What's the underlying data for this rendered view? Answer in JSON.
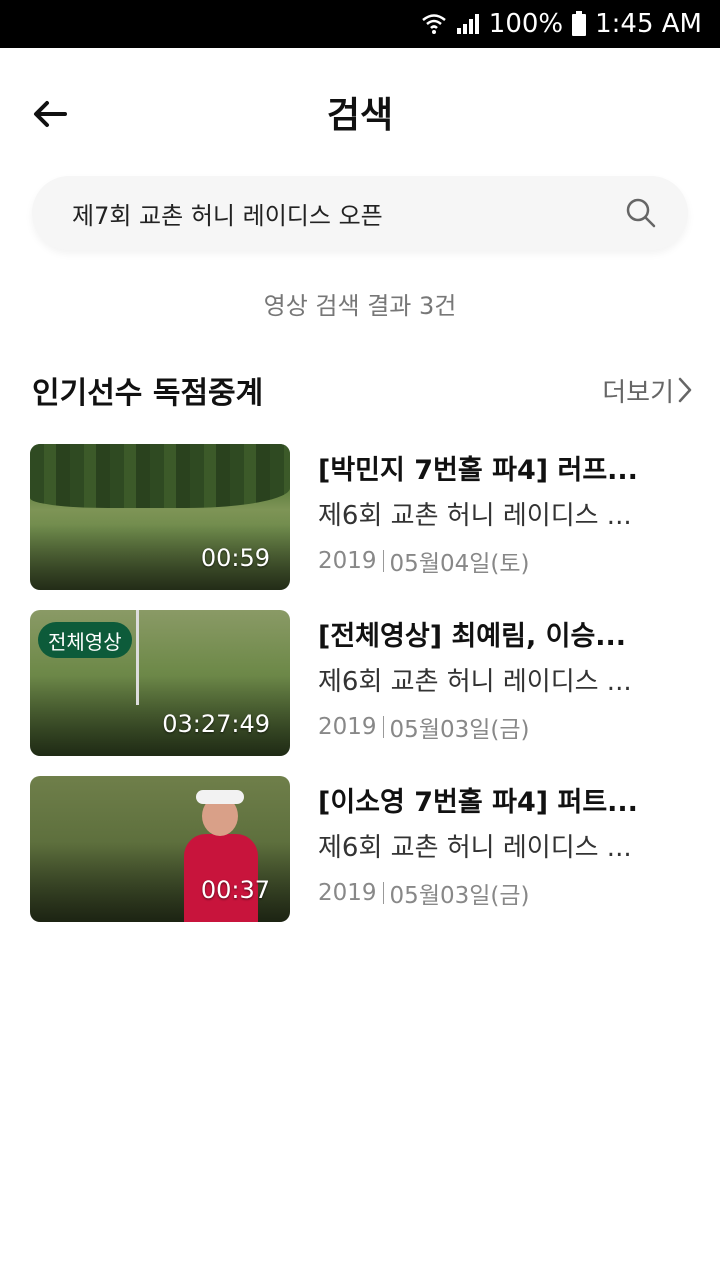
{
  "status": {
    "battery": "100%",
    "time": "1:45 AM"
  },
  "header": {
    "title": "검색"
  },
  "search": {
    "value": "제7회 교촌 허니 레이디스 오픈",
    "placeholder": ""
  },
  "result_count": "영상 검색 결과 3건",
  "section": {
    "title": "인기선수 독점중계",
    "more_label": "더보기"
  },
  "videos": [
    {
      "title": "[박민지 7번홀 파4] 러프...",
      "subtitle": "제6회 교촌 허니 레이디스 ...",
      "year": "2019",
      "date": "05월04일(토)",
      "duration": "00:59",
      "badge": ""
    },
    {
      "title": "[전체영상] 최예림, 이승...",
      "subtitle": "제6회 교촌 허니 레이디스 ...",
      "year": "2019",
      "date": "05월03일(금)",
      "duration": "03:27:49",
      "badge": "전체영상"
    },
    {
      "title": "[이소영 7번홀 파4] 퍼트...",
      "subtitle": "제6회 교촌 허니 레이디스 ...",
      "year": "2019",
      "date": "05월03일(금)",
      "duration": "00:37",
      "badge": ""
    }
  ],
  "colors": {
    "badge_bg": "#0d5b3a"
  }
}
